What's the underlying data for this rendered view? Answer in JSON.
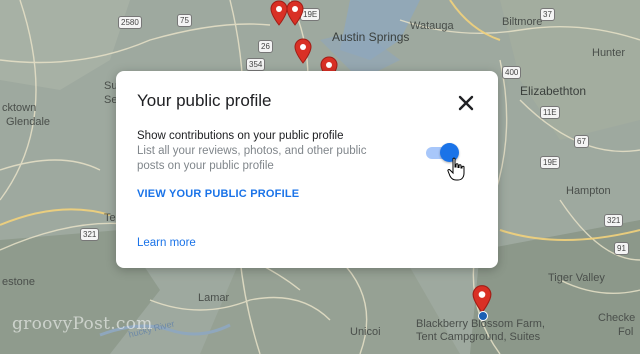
{
  "dialog": {
    "title": "Your public profile",
    "close_icon": "close-icon",
    "setting": {
      "title": "Show contributions on your public profile",
      "description": "List all your reviews, photos, and other public posts on your public profile",
      "toggle_on": true
    },
    "view_profile_link": "VIEW YOUR PUBLIC PROFILE",
    "learn_more_link": "Learn more"
  },
  "map": {
    "places": [
      "Austin Springs",
      "Watauga",
      "Biltmore",
      "Hunter",
      "Elizabethton",
      "Glendale",
      "cktown",
      "Su",
      "Se",
      "Tel",
      "Lamar",
      "Hampton",
      "Tiger Valley",
      "Unicoi",
      "Checke",
      "Fol",
      "estone",
      "Blackberry Blossom Farm,",
      "Tent Campground, Suites",
      "hucky River"
    ],
    "road_shields": [
      "2580",
      "75",
      "26",
      "354",
      "400",
      "321",
      "11E",
      "19E",
      "321",
      "91",
      "67",
      "37",
      "19E",
      "26"
    ]
  },
  "watermark": "groovyPost.com",
  "colors": {
    "accent": "#1a73e8",
    "toggle_track": "#a8c7fa",
    "map_pin": "#d93025"
  }
}
